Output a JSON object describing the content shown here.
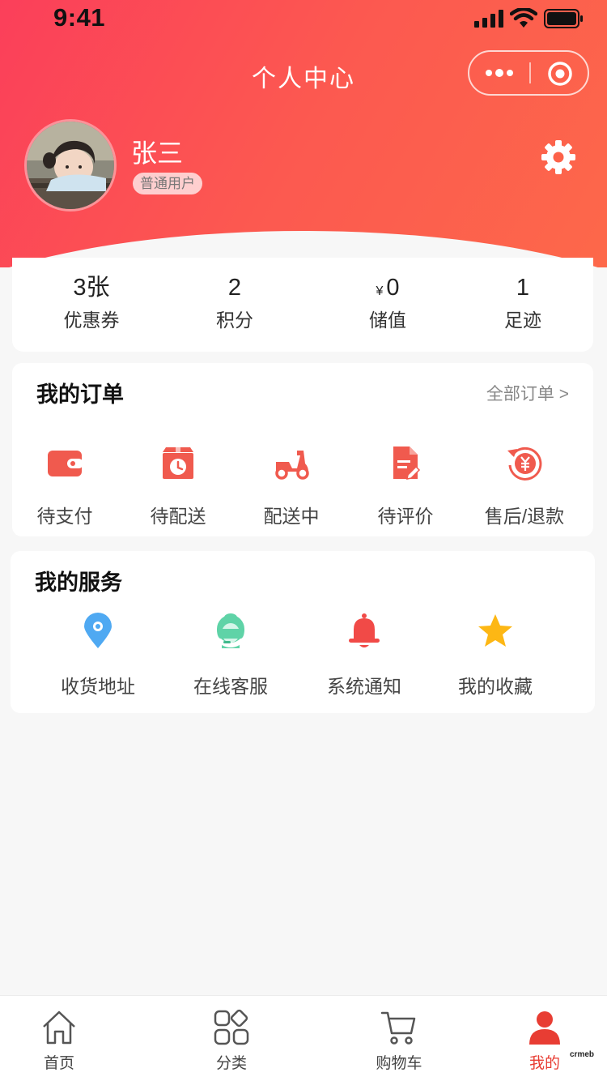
{
  "status_bar": {
    "time": "9:41"
  },
  "nav": {
    "title": "个人中心"
  },
  "user": {
    "name": "张三",
    "badge": "普通用户"
  },
  "stats": [
    {
      "value": "3张",
      "label": "优惠券"
    },
    {
      "value": "2",
      "label": "积分"
    },
    {
      "currency": "¥",
      "value": "0",
      "label": "储值"
    },
    {
      "value": "1",
      "label": "足迹"
    }
  ],
  "orders": {
    "title": "我的订单",
    "all_link": "全部订单 >",
    "items": [
      {
        "label": "待支付",
        "icon": "wallet-icon"
      },
      {
        "label": "待配送",
        "icon": "package-clock-icon"
      },
      {
        "label": "配送中",
        "icon": "scooter-icon"
      },
      {
        "label": "待评价",
        "icon": "review-document-icon"
      },
      {
        "label": "售后/退款",
        "icon": "refund-icon"
      }
    ]
  },
  "services": {
    "title": "我的服务",
    "items": [
      {
        "label": "收货地址",
        "icon": "location-pin-icon"
      },
      {
        "label": "在线客服",
        "icon": "customer-service-icon"
      },
      {
        "label": "系统通知",
        "icon": "bell-icon"
      },
      {
        "label": "我的收藏",
        "icon": "star-icon"
      }
    ]
  },
  "tabbar": {
    "active": "我的",
    "tabs": [
      {
        "label": "首页",
        "icon": "home-icon"
      },
      {
        "label": "分类",
        "icon": "category-icon"
      },
      {
        "label": "购物车",
        "icon": "cart-icon"
      },
      {
        "label": "我的",
        "icon": "user-icon"
      }
    ]
  },
  "colors": {
    "header_start": "#fb3f5a",
    "header_end": "#fd684a",
    "order_icon": "#f05a4e",
    "active_tab": "#e83d33",
    "pin": "#4fa9f2",
    "service": "#5fd3a7",
    "bell": "#f14a47",
    "star": "#fdb714"
  },
  "watermark": "crmeb"
}
